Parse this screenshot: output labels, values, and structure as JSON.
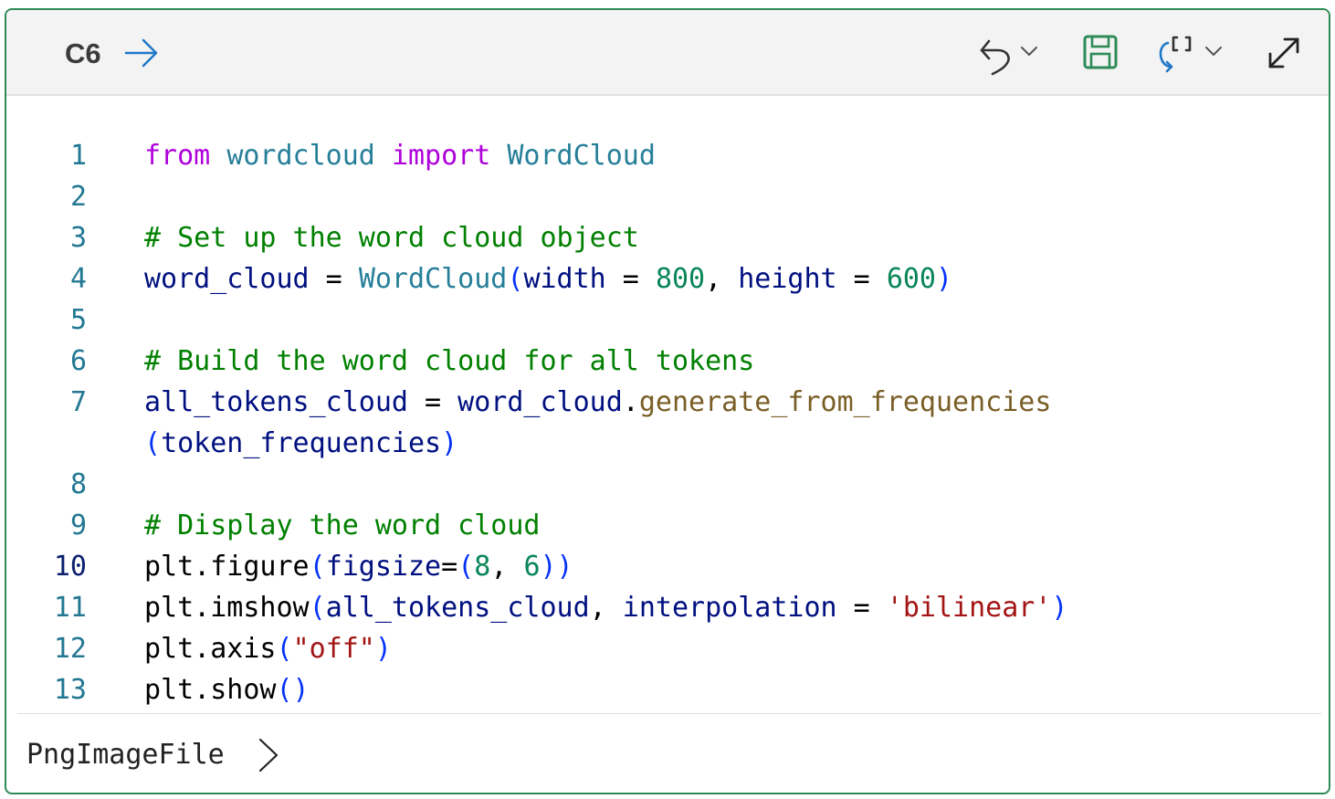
{
  "cell": {
    "id": "C6",
    "toolbar": {
      "run_icon": "arrow-right-icon",
      "undo_icon": "undo-icon",
      "save_icon": "save-icon",
      "refresh_icon": "refresh-brackets-icon",
      "expand_icon": "expand-icon"
    },
    "code_lines": [
      {
        "n": "1",
        "tokens": [
          [
            "kw",
            "from"
          ],
          [
            "",
            " "
          ],
          [
            "mod",
            "wordcloud"
          ],
          [
            "",
            " "
          ],
          [
            "kw",
            "import"
          ],
          [
            "",
            " "
          ],
          [
            "cls",
            "WordCloud"
          ]
        ]
      },
      {
        "n": "2",
        "tokens": []
      },
      {
        "n": "3",
        "tokens": [
          [
            "cm",
            "# Set up the word cloud object"
          ]
        ]
      },
      {
        "n": "4",
        "tokens": [
          [
            "var",
            "word_cloud"
          ],
          [
            "",
            " = "
          ],
          [
            "cls",
            "WordCloud"
          ],
          [
            "br",
            "("
          ],
          [
            "var",
            "width"
          ],
          [
            "",
            " = "
          ],
          [
            "num",
            "800"
          ],
          [
            "",
            ", "
          ],
          [
            "var",
            "height"
          ],
          [
            "",
            " = "
          ],
          [
            "num",
            "600"
          ],
          [
            "br",
            ")"
          ]
        ]
      },
      {
        "n": "5",
        "tokens": []
      },
      {
        "n": "6",
        "tokens": [
          [
            "cm",
            "# Build the word cloud for all tokens"
          ]
        ]
      },
      {
        "n": "7",
        "tokens": [
          [
            "var",
            "all_tokens_cloud"
          ],
          [
            "",
            " = "
          ],
          [
            "var",
            "word_cloud"
          ],
          [
            "",
            "."
          ],
          [
            "fn",
            "generate_from_frequencies"
          ]
        ]
      },
      {
        "n": "",
        "tokens": [
          [
            "br",
            "("
          ],
          [
            "var",
            "token_frequencies"
          ],
          [
            "br",
            ")"
          ]
        ]
      },
      {
        "n": "8",
        "tokens": []
      },
      {
        "n": "9",
        "tokens": [
          [
            "cm",
            "# Display the word cloud"
          ]
        ]
      },
      {
        "n": "10",
        "tokens": [
          [
            "",
            "plt.figure"
          ],
          [
            "br",
            "("
          ],
          [
            "var",
            "figsize"
          ],
          [
            "",
            "="
          ],
          [
            "br",
            "("
          ],
          [
            "num",
            "8"
          ],
          [
            "",
            ", "
          ],
          [
            "num",
            "6"
          ],
          [
            "br",
            "))"
          ]
        ]
      },
      {
        "n": "11",
        "tokens": [
          [
            "",
            "plt.imshow"
          ],
          [
            "br",
            "("
          ],
          [
            "var",
            "all_tokens_cloud"
          ],
          [
            "",
            ", "
          ],
          [
            "var",
            "interpolation"
          ],
          [
            "",
            " = "
          ],
          [
            "str",
            "'bilinear'"
          ],
          [
            "br",
            ")"
          ]
        ]
      },
      {
        "n": "12",
        "tokens": [
          [
            "",
            "plt.axis"
          ],
          [
            "br",
            "("
          ],
          [
            "str",
            "\"off\""
          ],
          [
            "br",
            ")"
          ]
        ]
      },
      {
        "n": "13",
        "tokens": [
          [
            "",
            "plt.show"
          ],
          [
            "br",
            "()"
          ]
        ]
      }
    ],
    "active_line": "10",
    "output": {
      "label": "PngImageFile",
      "chevron_icon": "chevron-right-icon"
    }
  },
  "colors": {
    "border": "#2e8b57",
    "toolbar_bg": "#f3f3f3",
    "save_icon": "#2e8b57",
    "refresh_icon": "#1e78c8",
    "run_arrow": "#1e78c8"
  }
}
